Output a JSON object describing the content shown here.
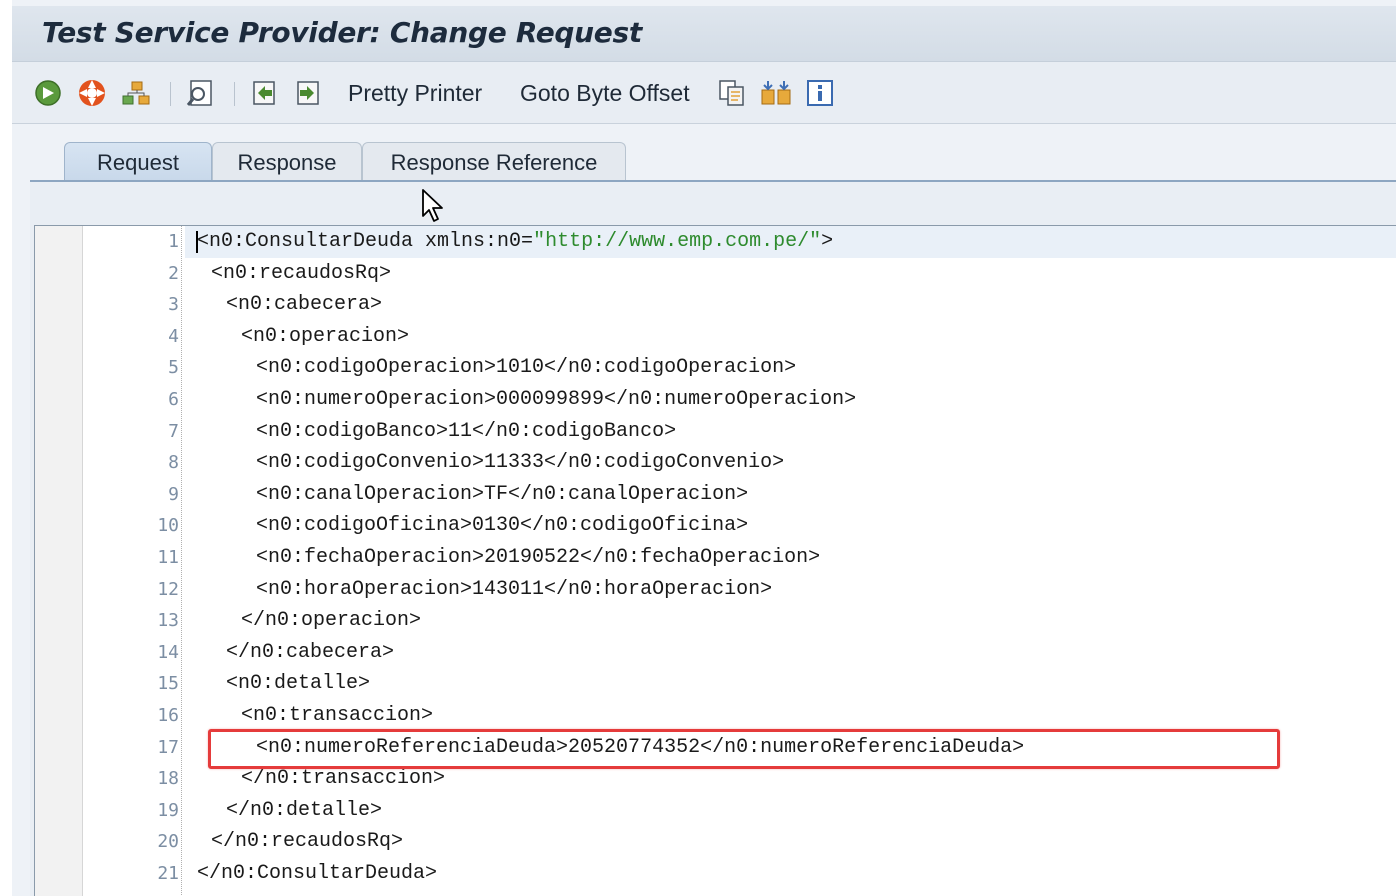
{
  "window": {
    "title": "Test Service Provider: Change Request"
  },
  "toolbar": {
    "icons": [
      "execute-icon",
      "lifebuoy-icon",
      "hierarchy-icon",
      "display-icon",
      "import-icon",
      "export-icon",
      "copy-icon",
      "compare-icon",
      "info-icon"
    ],
    "pretty_printer_label": "Pretty Printer",
    "goto_byte_offset_label": "Goto Byte Offset"
  },
  "tabs": [
    {
      "label": "Request",
      "active": true
    },
    {
      "label": "Response",
      "active": false
    },
    {
      "label": "Response Reference",
      "active": false
    }
  ],
  "editor": {
    "lines": [
      {
        "num": "1",
        "indent": 0,
        "pre": "<n0:ConsultarDeuda xmlns:n0=",
        "str": "\"http://www.emp.com.pe/\"",
        "post": ">"
      },
      {
        "num": "2",
        "indent": 1,
        "text": "<n0:recaudosRq>"
      },
      {
        "num": "3",
        "indent": 2,
        "text": "<n0:cabecera>"
      },
      {
        "num": "4",
        "indent": 3,
        "text": "<n0:operacion>"
      },
      {
        "num": "5",
        "indent": 4,
        "text": "<n0:codigoOperacion>1010</n0:codigoOperacion>"
      },
      {
        "num": "6",
        "indent": 4,
        "text": "<n0:numeroOperacion>000099899</n0:numeroOperacion>"
      },
      {
        "num": "7",
        "indent": 4,
        "text": "<n0:codigoBanco>11</n0:codigoBanco>"
      },
      {
        "num": "8",
        "indent": 4,
        "text": "<n0:codigoConvenio>11333</n0:codigoConvenio>"
      },
      {
        "num": "9",
        "indent": 4,
        "text": "<n0:canalOperacion>TF</n0:canalOperacion>"
      },
      {
        "num": "10",
        "indent": 4,
        "text": "<n0:codigoOficina>0130</n0:codigoOficina>"
      },
      {
        "num": "11",
        "indent": 4,
        "text": "<n0:fechaOperacion>20190522</n0:fechaOperacion>"
      },
      {
        "num": "12",
        "indent": 4,
        "text": "<n0:horaOperacion>143011</n0:horaOperacion>"
      },
      {
        "num": "13",
        "indent": 3,
        "text": "</n0:operacion>"
      },
      {
        "num": "14",
        "indent": 2,
        "text": "</n0:cabecera>"
      },
      {
        "num": "15",
        "indent": 2,
        "text": "<n0:detalle>"
      },
      {
        "num": "16",
        "indent": 3,
        "text": "<n0:transaccion>"
      },
      {
        "num": "17",
        "indent": 4,
        "text": "<n0:numeroReferenciaDeuda>20520774352</n0:numeroReferenciaDeuda>"
      },
      {
        "num": "18",
        "indent": 3,
        "text": "</n0:transaccion>"
      },
      {
        "num": "19",
        "indent": 2,
        "text": "</n0:detalle>"
      },
      {
        "num": "20",
        "indent": 1,
        "text": "</n0:recaudosRq>"
      },
      {
        "num": "21",
        "indent": 0,
        "text": "</n0:ConsultarDeuda>"
      }
    ]
  },
  "colors": {
    "string": "#2e8b2e",
    "line_numbers": "#7c8ea3",
    "highlight_box": "#e53b3b",
    "active_line": "#e9f0f8"
  }
}
